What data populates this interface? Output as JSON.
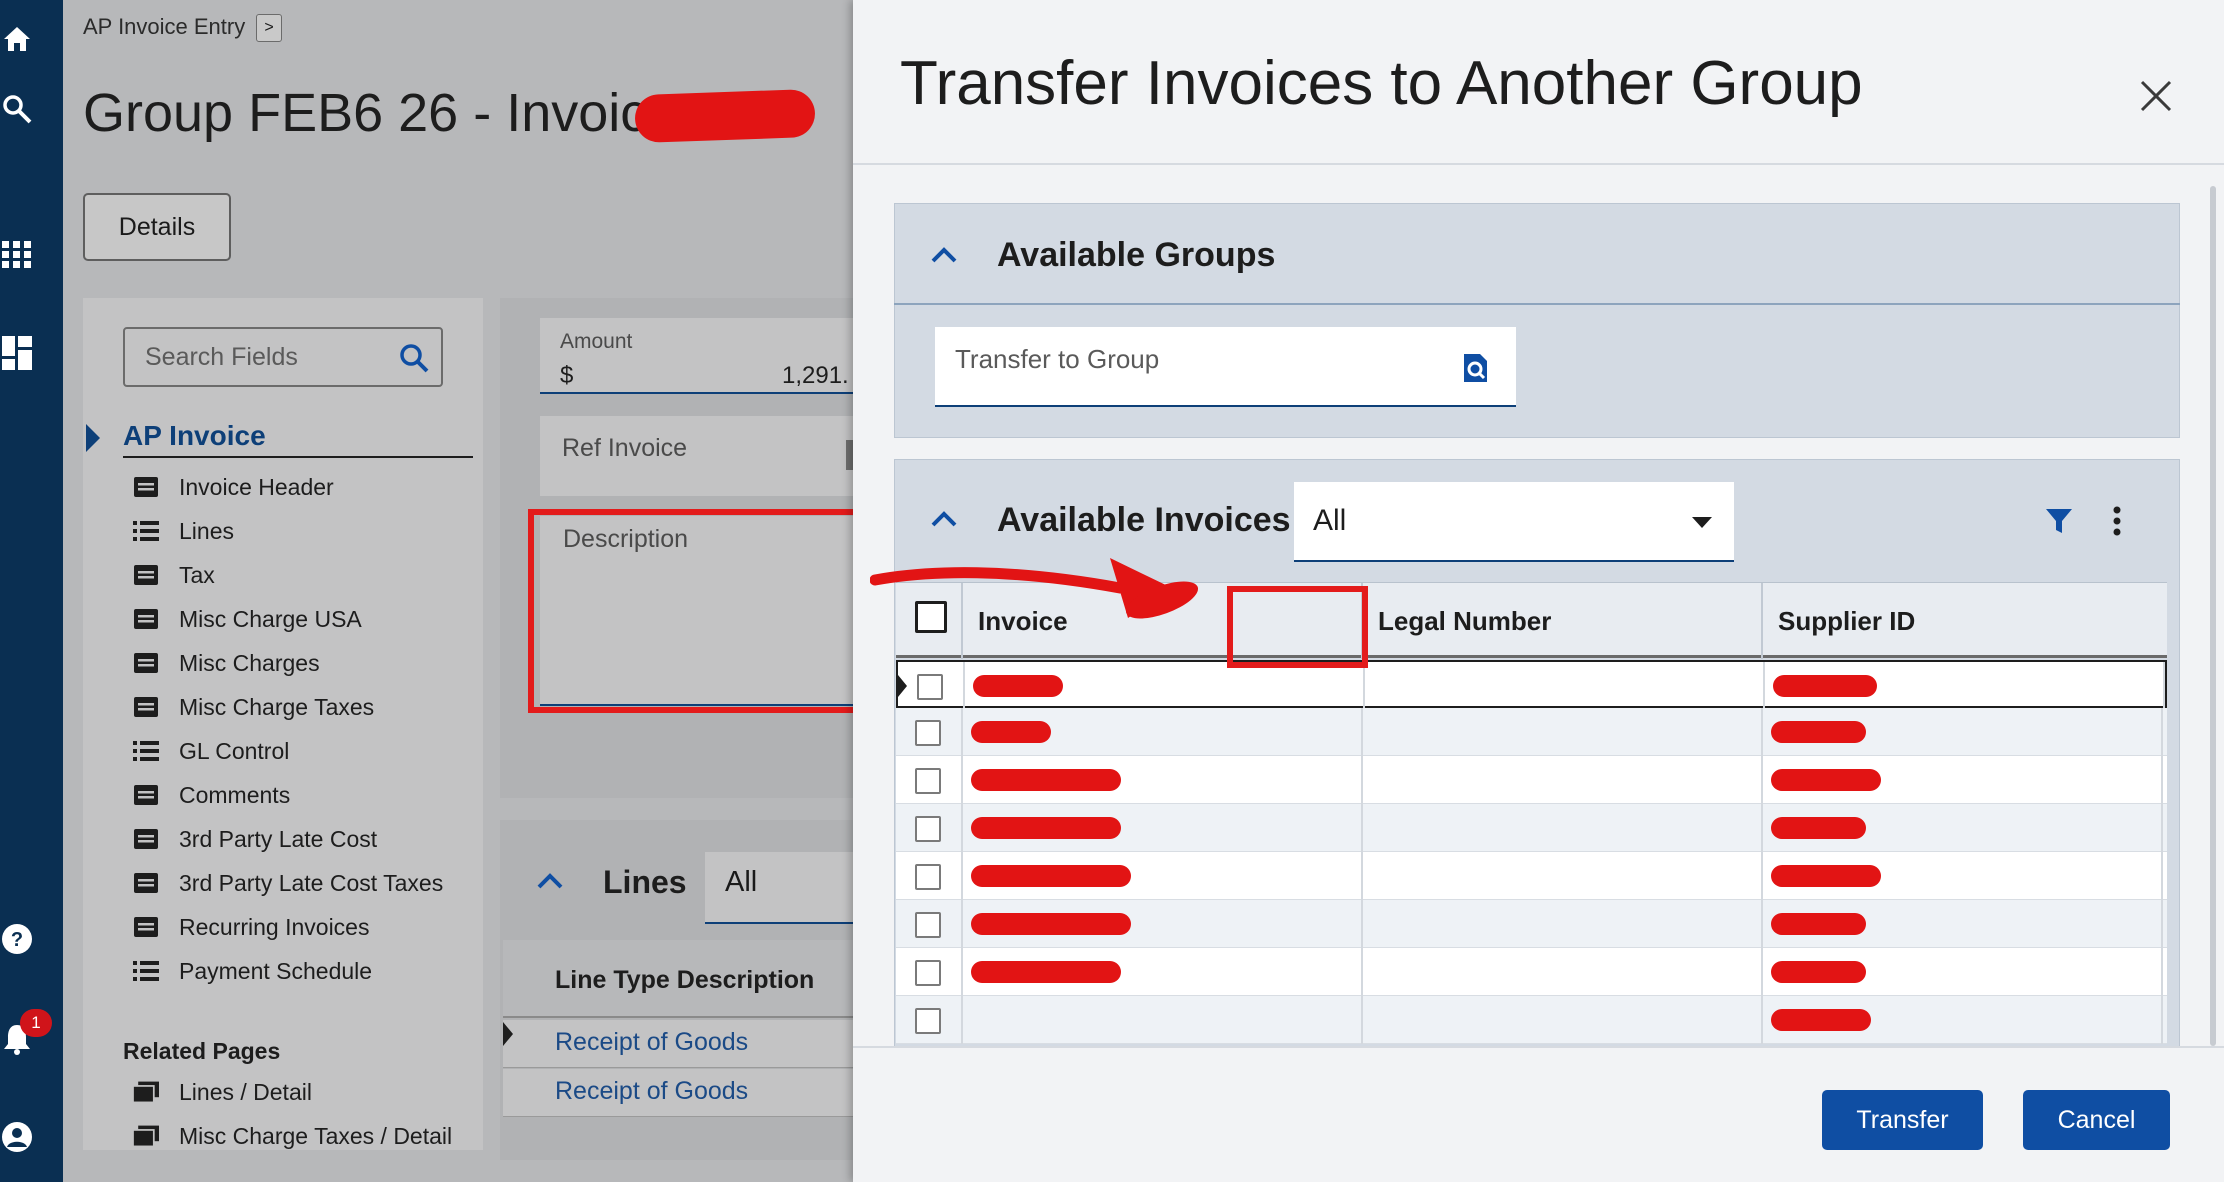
{
  "breadcrumb": {
    "label": "AP Invoice Entry",
    "chevron": ">"
  },
  "page": {
    "title": "Group FEB6 26 - Invoice",
    "details_button": "Details"
  },
  "left_panel": {
    "search_placeholder": "Search Fields",
    "section": "AP Invoice",
    "items": [
      {
        "label": "Invoice Header",
        "icon": "card-icon"
      },
      {
        "label": "Lines",
        "icon": "list-icon"
      },
      {
        "label": "Tax",
        "icon": "card-icon"
      },
      {
        "label": "Misc Charge USA",
        "icon": "card-icon"
      },
      {
        "label": "Misc Charges",
        "icon": "card-icon"
      },
      {
        "label": "Misc Charge Taxes",
        "icon": "card-icon"
      },
      {
        "label": "GL Control",
        "icon": "list-icon"
      },
      {
        "label": "Comments",
        "icon": "card-icon"
      },
      {
        "label": "3rd Party Late Cost",
        "icon": "card-icon"
      },
      {
        "label": "3rd Party Late Cost Taxes",
        "icon": "card-icon"
      },
      {
        "label": "Recurring Invoices",
        "icon": "card-icon"
      },
      {
        "label": "Payment Schedule",
        "icon": "list-icon"
      }
    ],
    "related_title": "Related Pages",
    "related": [
      {
        "label": "Lines / Detail",
        "icon": "stack-icon"
      },
      {
        "label": "Misc Charge Taxes / Detail",
        "icon": "stack-icon"
      }
    ]
  },
  "form": {
    "amount_label": "Amount",
    "amount_currency": "$",
    "amount_value": "1,291.",
    "ref_invoice_label": "Ref Invoice",
    "description_label": "Description"
  },
  "lines_section": {
    "title": "Lines",
    "filter": "All",
    "column": "Line Type Description",
    "rows": [
      "Receipt of Goods",
      "Receipt of Goods"
    ]
  },
  "rail": {
    "notification_count": "1"
  },
  "dialog": {
    "title": "Transfer Invoices to Another Group",
    "groups_section": "Available Groups",
    "transfer_to_group_placeholder": "Transfer to Group",
    "invoices_section": "Available Invoices",
    "invoices_filter": "All",
    "columns": [
      "Invoice",
      "",
      "Legal Number",
      "Supplier ID"
    ],
    "row_count": 8,
    "transfer_button": "Transfer",
    "cancel_button": "Cancel"
  },
  "colors": {
    "accent": "#0f4ea3",
    "rail": "#0a2f52",
    "annotation": "#e31b1b"
  }
}
